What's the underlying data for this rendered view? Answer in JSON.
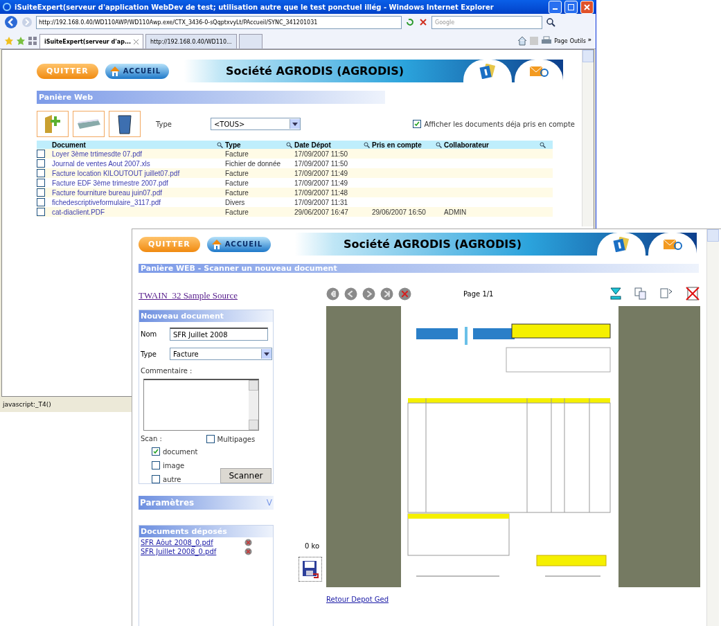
{
  "back_window": {
    "title": "iSuiteExpert(serveur d'application WebDev de test; utilisation autre que le test ponctuel illég - Windows Internet Explorer",
    "address": "http://192.168.0.40/WD110AWP/WD110Awp.exe/CTX_3436-0-sQqptxvyLt/PAccueil/SYNC_341201031",
    "search_placeholder": "Google",
    "tabs": [
      {
        "label": "iSuiteExpert(serveur d'ap...",
        "selected": true
      },
      {
        "label": "http://192.168.0.40/WD110...",
        "selected": false
      }
    ],
    "command_bar": [
      "Page",
      "Outils"
    ],
    "overflow": "»",
    "banner": {
      "quit": "QUITTER",
      "home": "ACCUEIL",
      "company": "Société AGRODIS (AGRODIS)"
    },
    "section": "Panière Web",
    "filter": {
      "label": "Type",
      "value": "<TOUS>"
    },
    "show_processed": {
      "label": "Afficher les documents déja pris en compte",
      "checked": true
    },
    "columns": [
      "Document",
      "Type",
      "Date Dépot",
      "Pris en compte",
      "Collaborateur"
    ],
    "rows": [
      {
        "checked": false,
        "document": "Loyer 3ème trtimesdte 07.pdf",
        "type": "Facture",
        "date": "17/09/2007 11:50"
      },
      {
        "checked": false,
        "document": "Journal de ventes Aout 2007.xls",
        "type": "Fichier de donnée",
        "date": "17/09/2007 11:50"
      },
      {
        "checked": false,
        "document": "Facture location KILOUTOUT juillet07.pdf",
        "type": "Facture",
        "date": "17/09/2007 11:49"
      },
      {
        "checked": false,
        "document": "Facture EDF 3ème trimestre 2007.pdf",
        "type": "Facture",
        "date": "17/09/2007 11:49"
      },
      {
        "checked": false,
        "document": "Facture fourniture bureau juin07.pdf",
        "type": "Facture",
        "date": "17/09/2007 11:48"
      },
      {
        "checked": false,
        "document": "fichedescriptiveformulaire_3117.pdf",
        "type": "Divers",
        "date": "17/09/2007 11:31"
      },
      {
        "checked": false,
        "document": "cat-diaclient.PDF",
        "type": "Facture",
        "date": "29/06/2007 16:47",
        "processed": "29/06/2007 16:50",
        "collaborator": "ADMIN"
      }
    ],
    "status": "javascript:_T4()"
  },
  "front_window": {
    "banner": {
      "quit": "QUITTER",
      "home": "ACCUEIL",
      "company": "Société AGRODIS (AGRODIS)"
    },
    "section": "Panière WEB - Scanner un nouveau document",
    "source_link": "TWAIN_32 Sample Source",
    "page_label": "Page 1/1",
    "new_document": {
      "title": "Nouveau document",
      "name_label": "Nom",
      "name_value": "SFR Juillet 2008",
      "type_label": "Type",
      "type_value": "Facture",
      "comment_label": "Commentaire :",
      "scan_label": "Scan :",
      "multipages": {
        "label": "Multipages",
        "checked": false
      },
      "scan_options": [
        {
          "label": "document",
          "checked": true
        },
        {
          "label": "image",
          "checked": false
        },
        {
          "label": "autre",
          "checked": false
        }
      ],
      "scan_button": "Scanner"
    },
    "parameters": {
      "title": "Paramètres",
      "toggle": "V"
    },
    "deposited": {
      "title": "Documents déposés",
      "files": [
        "SFR Aôut 2008_0.pdf",
        "SFR Juillet 2008_0.pdf"
      ]
    },
    "size": "0 ko",
    "back_link": "Retour Depot Ged"
  }
}
